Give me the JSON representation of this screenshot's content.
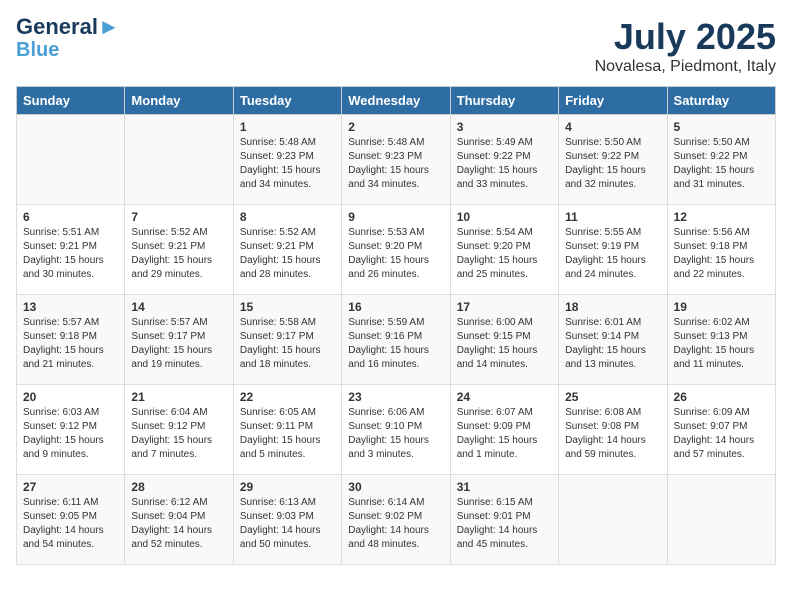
{
  "logo": {
    "line1": "General",
    "line2": "Blue"
  },
  "title": "July 2025",
  "location": "Novalesa, Piedmont, Italy",
  "headers": [
    "Sunday",
    "Monday",
    "Tuesday",
    "Wednesday",
    "Thursday",
    "Friday",
    "Saturday"
  ],
  "weeks": [
    [
      {
        "day": "",
        "sunrise": "",
        "sunset": "",
        "daylight": ""
      },
      {
        "day": "",
        "sunrise": "",
        "sunset": "",
        "daylight": ""
      },
      {
        "day": "1",
        "sunrise": "Sunrise: 5:48 AM",
        "sunset": "Sunset: 9:23 PM",
        "daylight": "Daylight: 15 hours and 34 minutes."
      },
      {
        "day": "2",
        "sunrise": "Sunrise: 5:48 AM",
        "sunset": "Sunset: 9:23 PM",
        "daylight": "Daylight: 15 hours and 34 minutes."
      },
      {
        "day": "3",
        "sunrise": "Sunrise: 5:49 AM",
        "sunset": "Sunset: 9:22 PM",
        "daylight": "Daylight: 15 hours and 33 minutes."
      },
      {
        "day": "4",
        "sunrise": "Sunrise: 5:50 AM",
        "sunset": "Sunset: 9:22 PM",
        "daylight": "Daylight: 15 hours and 32 minutes."
      },
      {
        "day": "5",
        "sunrise": "Sunrise: 5:50 AM",
        "sunset": "Sunset: 9:22 PM",
        "daylight": "Daylight: 15 hours and 31 minutes."
      }
    ],
    [
      {
        "day": "6",
        "sunrise": "Sunrise: 5:51 AM",
        "sunset": "Sunset: 9:21 PM",
        "daylight": "Daylight: 15 hours and 30 minutes."
      },
      {
        "day": "7",
        "sunrise": "Sunrise: 5:52 AM",
        "sunset": "Sunset: 9:21 PM",
        "daylight": "Daylight: 15 hours and 29 minutes."
      },
      {
        "day": "8",
        "sunrise": "Sunrise: 5:52 AM",
        "sunset": "Sunset: 9:21 PM",
        "daylight": "Daylight: 15 hours and 28 minutes."
      },
      {
        "day": "9",
        "sunrise": "Sunrise: 5:53 AM",
        "sunset": "Sunset: 9:20 PM",
        "daylight": "Daylight: 15 hours and 26 minutes."
      },
      {
        "day": "10",
        "sunrise": "Sunrise: 5:54 AM",
        "sunset": "Sunset: 9:20 PM",
        "daylight": "Daylight: 15 hours and 25 minutes."
      },
      {
        "day": "11",
        "sunrise": "Sunrise: 5:55 AM",
        "sunset": "Sunset: 9:19 PM",
        "daylight": "Daylight: 15 hours and 24 minutes."
      },
      {
        "day": "12",
        "sunrise": "Sunrise: 5:56 AM",
        "sunset": "Sunset: 9:18 PM",
        "daylight": "Daylight: 15 hours and 22 minutes."
      }
    ],
    [
      {
        "day": "13",
        "sunrise": "Sunrise: 5:57 AM",
        "sunset": "Sunset: 9:18 PM",
        "daylight": "Daylight: 15 hours and 21 minutes."
      },
      {
        "day": "14",
        "sunrise": "Sunrise: 5:57 AM",
        "sunset": "Sunset: 9:17 PM",
        "daylight": "Daylight: 15 hours and 19 minutes."
      },
      {
        "day": "15",
        "sunrise": "Sunrise: 5:58 AM",
        "sunset": "Sunset: 9:17 PM",
        "daylight": "Daylight: 15 hours and 18 minutes."
      },
      {
        "day": "16",
        "sunrise": "Sunrise: 5:59 AM",
        "sunset": "Sunset: 9:16 PM",
        "daylight": "Daylight: 15 hours and 16 minutes."
      },
      {
        "day": "17",
        "sunrise": "Sunrise: 6:00 AM",
        "sunset": "Sunset: 9:15 PM",
        "daylight": "Daylight: 15 hours and 14 minutes."
      },
      {
        "day": "18",
        "sunrise": "Sunrise: 6:01 AM",
        "sunset": "Sunset: 9:14 PM",
        "daylight": "Daylight: 15 hours and 13 minutes."
      },
      {
        "day": "19",
        "sunrise": "Sunrise: 6:02 AM",
        "sunset": "Sunset: 9:13 PM",
        "daylight": "Daylight: 15 hours and 11 minutes."
      }
    ],
    [
      {
        "day": "20",
        "sunrise": "Sunrise: 6:03 AM",
        "sunset": "Sunset: 9:12 PM",
        "daylight": "Daylight: 15 hours and 9 minutes."
      },
      {
        "day": "21",
        "sunrise": "Sunrise: 6:04 AM",
        "sunset": "Sunset: 9:12 PM",
        "daylight": "Daylight: 15 hours and 7 minutes."
      },
      {
        "day": "22",
        "sunrise": "Sunrise: 6:05 AM",
        "sunset": "Sunset: 9:11 PM",
        "daylight": "Daylight: 15 hours and 5 minutes."
      },
      {
        "day": "23",
        "sunrise": "Sunrise: 6:06 AM",
        "sunset": "Sunset: 9:10 PM",
        "daylight": "Daylight: 15 hours and 3 minutes."
      },
      {
        "day": "24",
        "sunrise": "Sunrise: 6:07 AM",
        "sunset": "Sunset: 9:09 PM",
        "daylight": "Daylight: 15 hours and 1 minute."
      },
      {
        "day": "25",
        "sunrise": "Sunrise: 6:08 AM",
        "sunset": "Sunset: 9:08 PM",
        "daylight": "Daylight: 14 hours and 59 minutes."
      },
      {
        "day": "26",
        "sunrise": "Sunrise: 6:09 AM",
        "sunset": "Sunset: 9:07 PM",
        "daylight": "Daylight: 14 hours and 57 minutes."
      }
    ],
    [
      {
        "day": "27",
        "sunrise": "Sunrise: 6:11 AM",
        "sunset": "Sunset: 9:05 PM",
        "daylight": "Daylight: 14 hours and 54 minutes."
      },
      {
        "day": "28",
        "sunrise": "Sunrise: 6:12 AM",
        "sunset": "Sunset: 9:04 PM",
        "daylight": "Daylight: 14 hours and 52 minutes."
      },
      {
        "day": "29",
        "sunrise": "Sunrise: 6:13 AM",
        "sunset": "Sunset: 9:03 PM",
        "daylight": "Daylight: 14 hours and 50 minutes."
      },
      {
        "day": "30",
        "sunrise": "Sunrise: 6:14 AM",
        "sunset": "Sunset: 9:02 PM",
        "daylight": "Daylight: 14 hours and 48 minutes."
      },
      {
        "day": "31",
        "sunrise": "Sunrise: 6:15 AM",
        "sunset": "Sunset: 9:01 PM",
        "daylight": "Daylight: 14 hours and 45 minutes."
      },
      {
        "day": "",
        "sunrise": "",
        "sunset": "",
        "daylight": ""
      },
      {
        "day": "",
        "sunrise": "",
        "sunset": "",
        "daylight": ""
      }
    ]
  ]
}
